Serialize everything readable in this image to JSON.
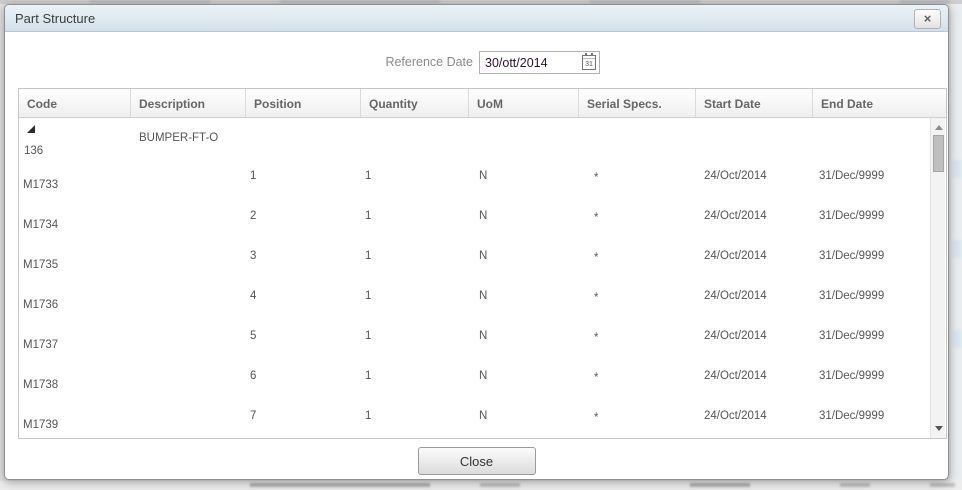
{
  "dialog": {
    "title": "Part Structure",
    "close_x": "×"
  },
  "toolbar": {
    "reference_date_label": "Reference Date",
    "reference_date_value": "30/ott/2014",
    "calendar_day": "31"
  },
  "table": {
    "columns": [
      "Code",
      "Description",
      "Position",
      "Quantity",
      "UoM",
      "Serial Specs.",
      "Start Date",
      "End Date"
    ],
    "parent_row": {
      "code": "136",
      "description": "BUMPER-FT-O"
    },
    "rows": [
      {
        "code": "M1733",
        "position": "1",
        "quantity": "1",
        "uom": "N",
        "serial_specs": "*",
        "start_date": "24/Oct/2014",
        "end_date": "31/Dec/9999"
      },
      {
        "code": "M1734",
        "position": "2",
        "quantity": "1",
        "uom": "N",
        "serial_specs": "*",
        "start_date": "24/Oct/2014",
        "end_date": "31/Dec/9999"
      },
      {
        "code": "M1735",
        "position": "3",
        "quantity": "1",
        "uom": "N",
        "serial_specs": "*",
        "start_date": "24/Oct/2014",
        "end_date": "31/Dec/9999"
      },
      {
        "code": "M1736",
        "position": "4",
        "quantity": "1",
        "uom": "N",
        "serial_specs": "*",
        "start_date": "24/Oct/2014",
        "end_date": "31/Dec/9999"
      },
      {
        "code": "M1737",
        "position": "5",
        "quantity": "1",
        "uom": "N",
        "serial_specs": "*",
        "start_date": "24/Oct/2014",
        "end_date": "31/Dec/9999"
      },
      {
        "code": "M1738",
        "position": "6",
        "quantity": "1",
        "uom": "N",
        "serial_specs": "*",
        "start_date": "24/Oct/2014",
        "end_date": "31/Dec/9999"
      },
      {
        "code": "M1739",
        "position": "7",
        "quantity": "1",
        "uom": "N",
        "serial_specs": "*",
        "start_date": "24/Oct/2014",
        "end_date": "31/Dec/9999"
      }
    ]
  },
  "footer": {
    "close_label": "Close"
  },
  "colors": {
    "titlebar_gradient_top": "#eaf2f7",
    "titlebar_gradient_bottom": "#d4e1ea",
    "dialog_border": "#8f8f8f",
    "header_text": "#666666",
    "cell_text": "#555555",
    "scrollbar_thumb": "#bfbfbf"
  }
}
